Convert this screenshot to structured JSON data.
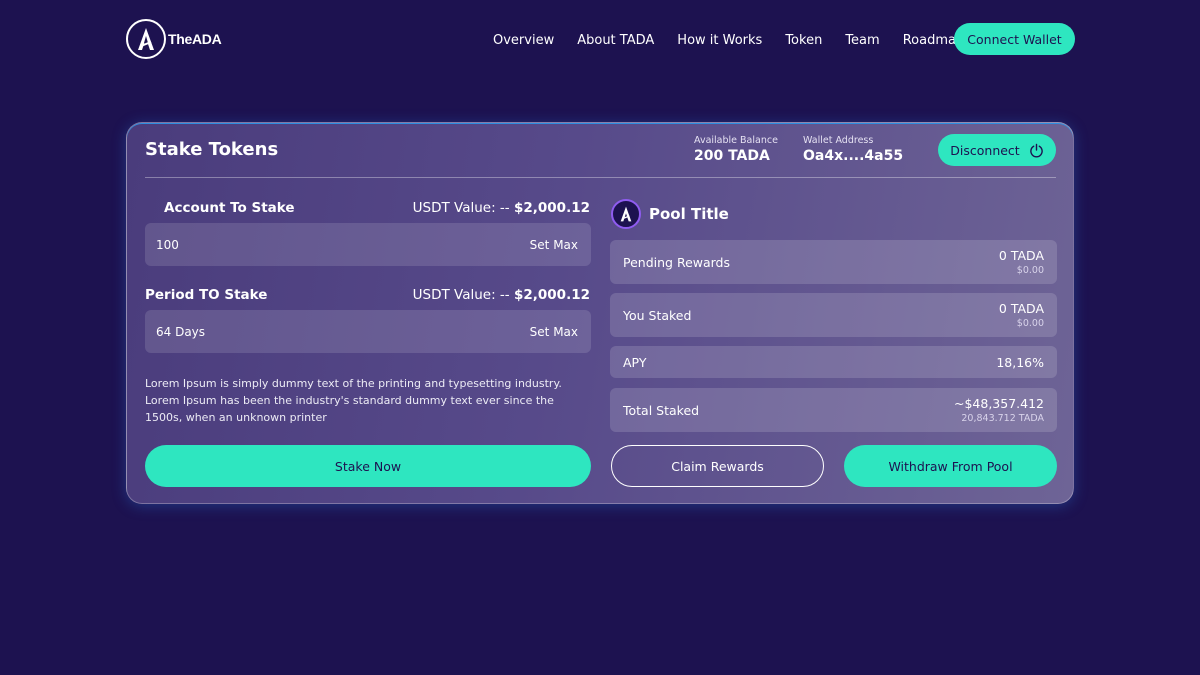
{
  "brand": {
    "logo_text": "TheADA",
    "logo_icon": "a-logo-icon"
  },
  "nav": {
    "items": [
      {
        "label": "Overview"
      },
      {
        "label": "About TADA"
      },
      {
        "label": "How it Works"
      },
      {
        "label": "Token"
      },
      {
        "label": "Team"
      },
      {
        "label": "Roadmap"
      }
    ],
    "connect_label": "Connect Wallet"
  },
  "stake": {
    "title": "Stake Tokens",
    "balance_label": "Available Balance",
    "balance_value": "200 TADA",
    "address_label": "Wallet Address",
    "address_value": "Oa4x....4a55",
    "disconnect_label": "Disconnect",
    "account": {
      "label": "Account To Stake",
      "usdt_prefix": "USDT Value: --",
      "usdt_value": "$2,000.12",
      "input_value": "100",
      "set_max": "Set Max"
    },
    "period": {
      "label": "Period TO Stake",
      "usdt_prefix": "USDT Value: --",
      "usdt_value": "$2,000.12",
      "input_value": "64 Days",
      "set_max": "Set Max"
    },
    "description": "Lorem Ipsum is simply dummy text of the printing and typesetting industry. Lorem Ipsum has been the industry's standard dummy text ever since the 1500s, when an unknown printer",
    "stake_button": "Stake Now"
  },
  "pool": {
    "title": "Pool Title",
    "rows": [
      {
        "label": "Pending Rewards",
        "value": "0 TADA",
        "sub": "$0.00"
      },
      {
        "label": "You Staked",
        "value": "0 TADA",
        "sub": "$0.00"
      },
      {
        "label": "APY",
        "value": "18,16%",
        "sub": ""
      },
      {
        "label": "Total Staked",
        "value": "~$48,357.412",
        "sub": "20,843.712 TADA"
      }
    ],
    "claim_button": "Claim Rewards",
    "withdraw_button": "Withdraw From Pool"
  },
  "colors": {
    "background": "#1d1250",
    "accent": "#2ee6c0",
    "pool_badge_ring": "#8f5cf0"
  }
}
